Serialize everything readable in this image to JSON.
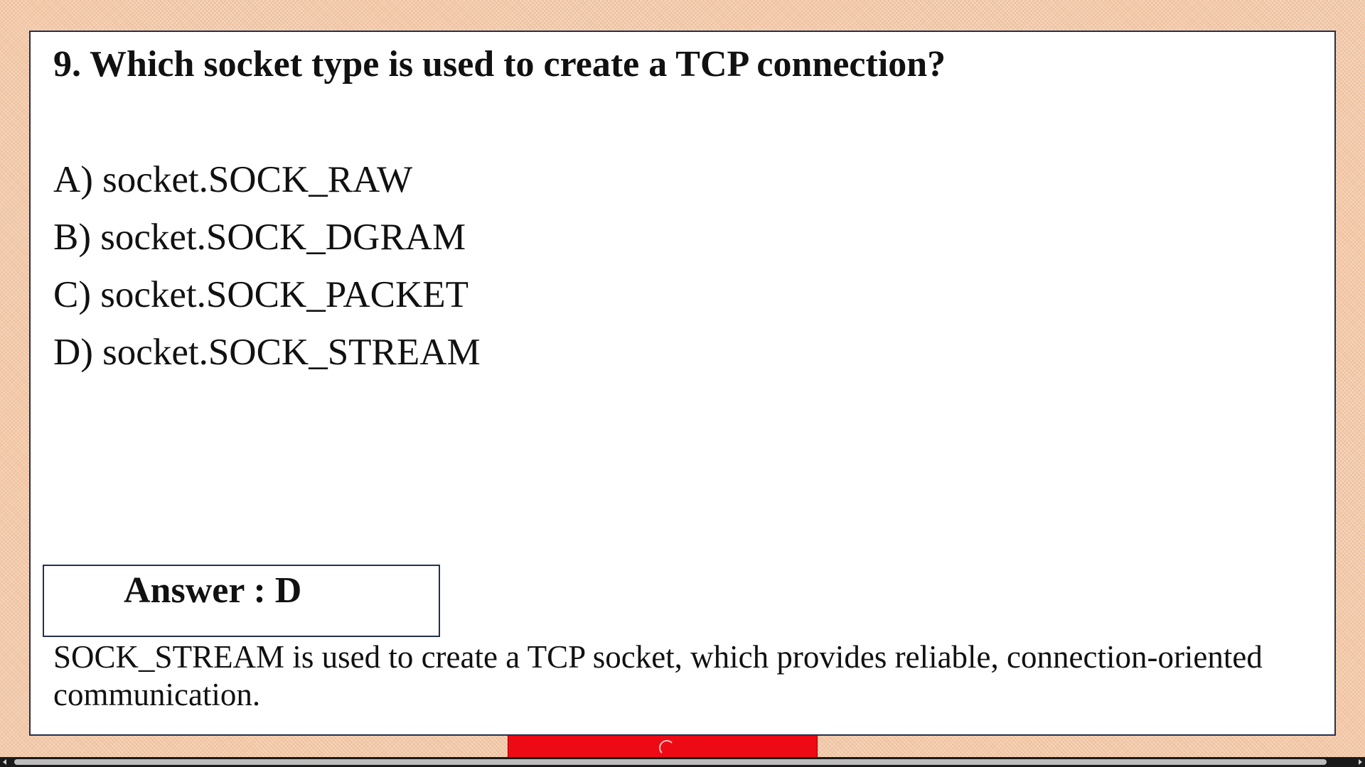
{
  "slide": {
    "question": "9. Which socket type is used to create a TCP connection?",
    "options": [
      "A) socket.SOCK_RAW",
      "B) socket.SOCK_DGRAM",
      "C) socket.SOCK_PACKET",
      "D) socket.SOCK_STREAM"
    ],
    "answer": "Answer : D",
    "explanation": "SOCK_STREAM is used to create a TCP socket, which provides reliable, connection-oriented communication."
  },
  "colors": {
    "background": "#f2c9a8",
    "slide_border": "#23304f",
    "red_tab": "#ee0a14",
    "scrollbar": "#1a1a1a"
  },
  "icons": {
    "scroll_left": "scroll-left-arrow-icon",
    "scroll_right": "scroll-right-arrow-icon",
    "red_tab_glyph": "loading-spinner-icon"
  }
}
